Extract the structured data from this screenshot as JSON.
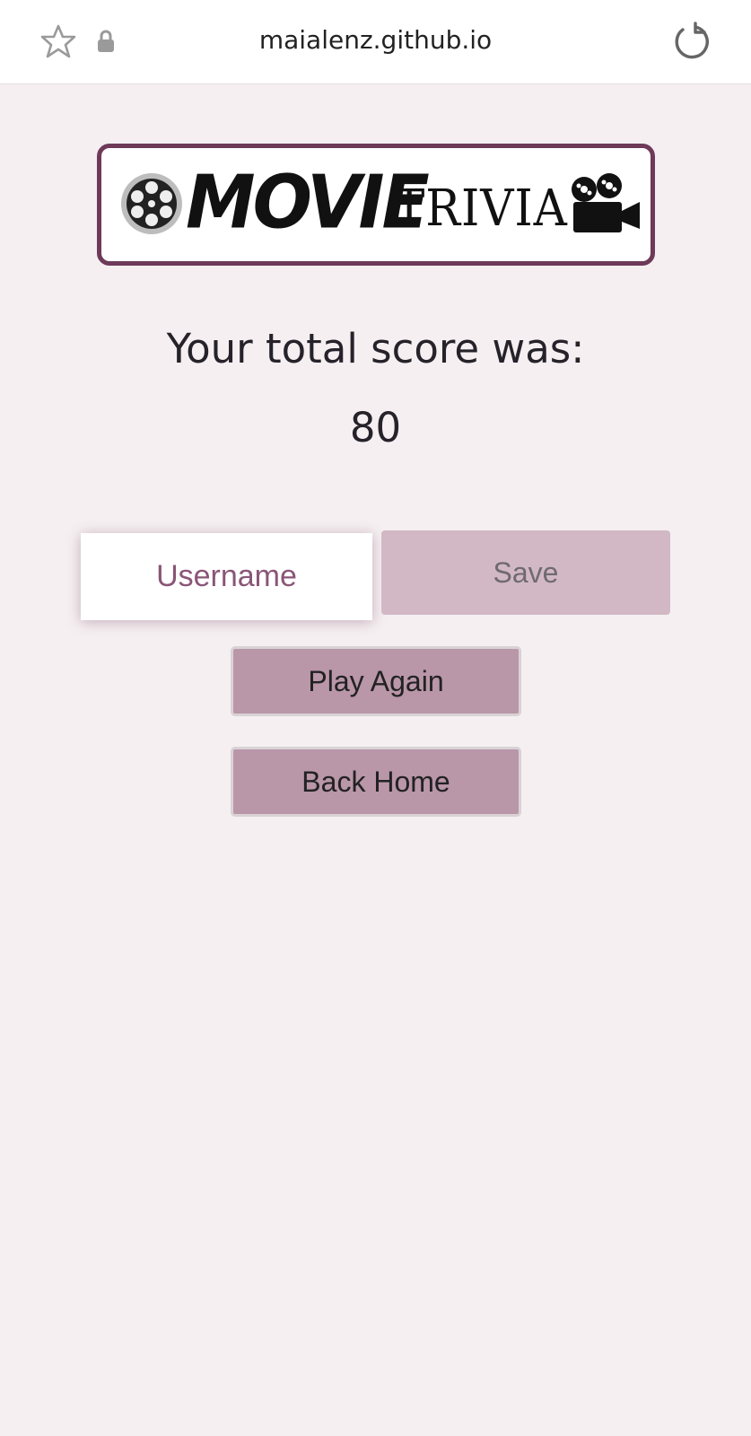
{
  "browser": {
    "url": "maialenz.github.io",
    "icons": [
      "star-icon",
      "lock-icon",
      "reload-icon"
    ]
  },
  "logo": {
    "word_movie": "MOVIE",
    "word_trivia": "TRIVIA",
    "icons": [
      "film-reel-icon",
      "movie-camera-icon"
    ],
    "border_color": "#6e3a5a"
  },
  "result": {
    "label": "Your total score was:",
    "score": "80"
  },
  "save_form": {
    "username_placeholder": "Username",
    "save_label": "Save"
  },
  "actions": {
    "play_again_label": "Play Again",
    "back_home_label": "Back Home"
  },
  "colors": {
    "background": "#f5eff1",
    "accent": "#b996a8",
    "save_button": "#d2b8c5",
    "placeholder_text": "#8a5577"
  }
}
